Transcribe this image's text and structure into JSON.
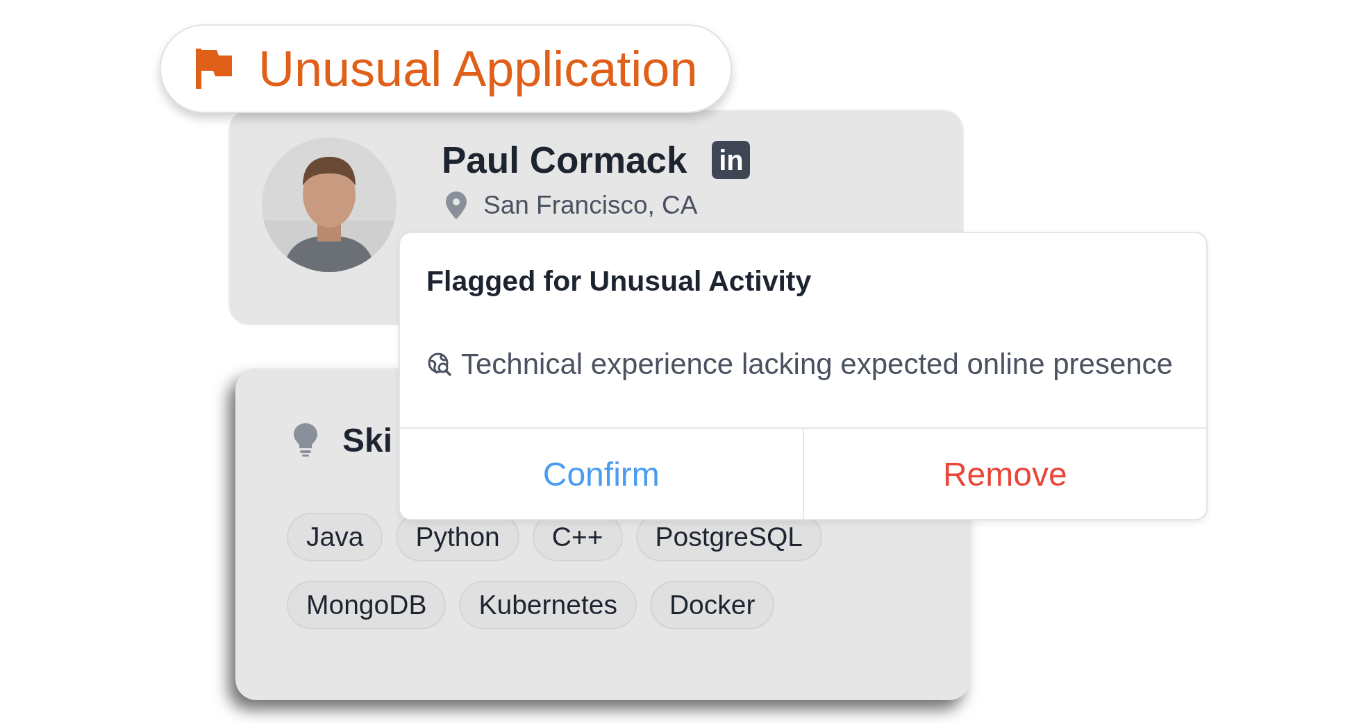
{
  "badge": {
    "label": "Unusual Application"
  },
  "profile": {
    "name": "Paul Cormack",
    "social": "in",
    "location": "San Francisco, CA"
  },
  "skills": {
    "title": "Ski",
    "tags": [
      {
        "label": "Java"
      },
      {
        "label": "Python"
      },
      {
        "label": "C++"
      },
      {
        "label": "PostgreSQL"
      },
      {
        "label": "MongoDB"
      },
      {
        "label": "Kubernetes"
      },
      {
        "label": "Docker"
      }
    ]
  },
  "popup": {
    "title": "Flagged for Unusual Activity",
    "reason": "Technical experience lacking expected online presence",
    "actions": [
      {
        "label": "Confirm",
        "kind": "confirm"
      },
      {
        "label": "Remove",
        "kind": "remove"
      }
    ]
  }
}
